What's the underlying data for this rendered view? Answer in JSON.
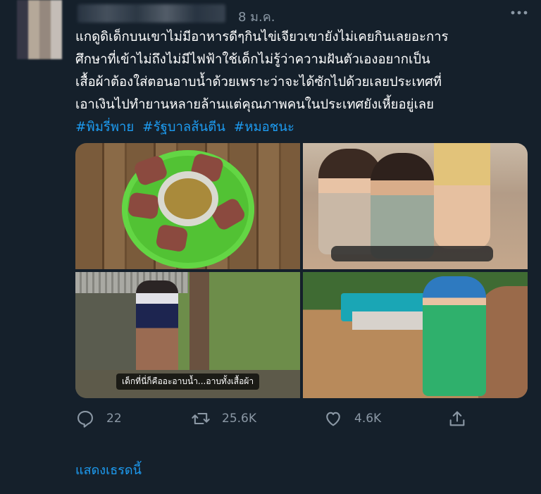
{
  "tweet": {
    "date": "8 ม.ค.",
    "lines": [
      "แกดูดิเด็กบนเขาไม่มีอาหารดีๆกินไข่เจียวเขายังไม่เคยกินเลยอะการ",
      "ศึกษาที่เข้าไม่ถึงไม่มีไฟฟ้าใช้เด็กไม่รู้ว่าความฝันตัวเองอยากเป็น",
      "เสื้อผ้าต้องใส่ตอนอาบน้ำด้วยเพราะว่าจะได้ซักไปด้วยเลยประเทศที่",
      "เอาเงินไปทำยานหลายล้านแต่คุณภาพคนในประเทศยังเหี้ยอยู่เลย"
    ],
    "hashtags": [
      "#พิมรี่พาย",
      "#รัฐบาลส้นตีน",
      "#หมอชนะ"
    ],
    "photo_caption": "เด็กที่นี่ก็คืออะอาบน้ำ...อาบทั้งเสื้อผ้า"
  },
  "actions": {
    "reply_count": "22",
    "retweet_count": "25.6K",
    "like_count": "4.6K"
  },
  "show_thread": "แสดงเธรดนี้",
  "icons": {
    "reply": "reply-icon",
    "retweet": "retweet-icon",
    "like": "heart-icon",
    "share": "share-icon",
    "more": "more-icon"
  },
  "colors": {
    "background": "#15202b",
    "accent": "#1d9bf0",
    "muted": "#8b98a5"
  }
}
